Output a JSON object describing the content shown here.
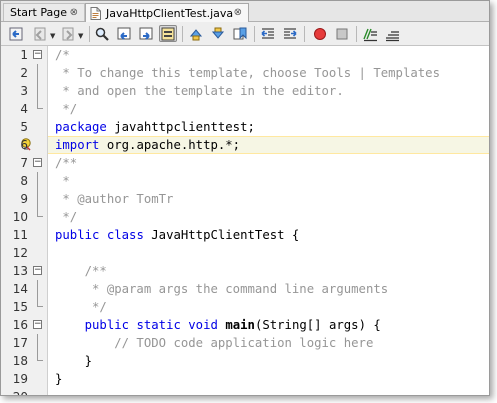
{
  "tabs": [
    {
      "label": "Start Page",
      "close": "⊗",
      "active": false
    },
    {
      "label": "JavaHttpClientTest.java",
      "close": "⊗",
      "active": true
    }
  ],
  "toolbar": {
    "buttons": [
      "last-edit-icon",
      "back-icon",
      "forward-icon",
      "find-icon",
      "find-previous-icon",
      "find-next-icon",
      "toggle-highlight-icon",
      "previous-bookmark-icon",
      "next-bookmark-icon",
      "toggle-bookmark-icon",
      "shift-left-icon",
      "shift-right-icon",
      "start-macro-icon",
      "stop-macro-icon",
      "comment-icon",
      "uncomment-icon"
    ]
  },
  "editor": {
    "line_numbers": [
      "1",
      "2",
      "3",
      "4",
      "5",
      "6",
      "7",
      "8",
      "9",
      "10",
      "11",
      "12",
      "13",
      "14",
      "15",
      "16",
      "17",
      "18",
      "19",
      "20"
    ],
    "lines": [
      [
        {
          "t": "/*",
          "c": "c"
        }
      ],
      [
        {
          "t": " * To change this template, choose Tools | Templates",
          "c": "c"
        }
      ],
      [
        {
          "t": " * and open the template in the editor.",
          "c": "c"
        }
      ],
      [
        {
          "t": " */",
          "c": "c"
        }
      ],
      [
        {
          "t": "package",
          "c": "k"
        },
        {
          "t": " javahttpclienttest;",
          "c": ""
        }
      ],
      [
        {
          "t": "import",
          "c": "k"
        },
        {
          "t": " org.apache.http.*;",
          "c": ""
        }
      ],
      [
        {
          "t": "/**",
          "c": "c"
        }
      ],
      [
        {
          "t": " *",
          "c": "c"
        }
      ],
      [
        {
          "t": " * @author TomTr",
          "c": "c"
        }
      ],
      [
        {
          "t": " */",
          "c": "c"
        }
      ],
      [
        {
          "t": "public",
          "c": "k"
        },
        {
          "t": " ",
          "c": ""
        },
        {
          "t": "class",
          "c": "k"
        },
        {
          "t": " JavaHttpClientTest {",
          "c": ""
        }
      ],
      [],
      [
        {
          "t": "    /**",
          "c": "c"
        }
      ],
      [
        {
          "t": "     * @param args the command line arguments",
          "c": "c"
        }
      ],
      [
        {
          "t": "     */",
          "c": "c"
        }
      ],
      [
        {
          "t": "    ",
          "c": ""
        },
        {
          "t": "public",
          "c": "k"
        },
        {
          "t": " ",
          "c": ""
        },
        {
          "t": "static",
          "c": "k"
        },
        {
          "t": " ",
          "c": ""
        },
        {
          "t": "void",
          "c": "k"
        },
        {
          "t": " ",
          "c": ""
        },
        {
          "t": "main",
          "c": "b"
        },
        {
          "t": "(String[] args) {",
          "c": ""
        }
      ],
      [
        {
          "t": "        // TODO code application logic here",
          "c": "c"
        }
      ],
      [
        {
          "t": "    }",
          "c": ""
        }
      ],
      [
        {
          "t": "}",
          "c": ""
        }
      ],
      []
    ]
  }
}
